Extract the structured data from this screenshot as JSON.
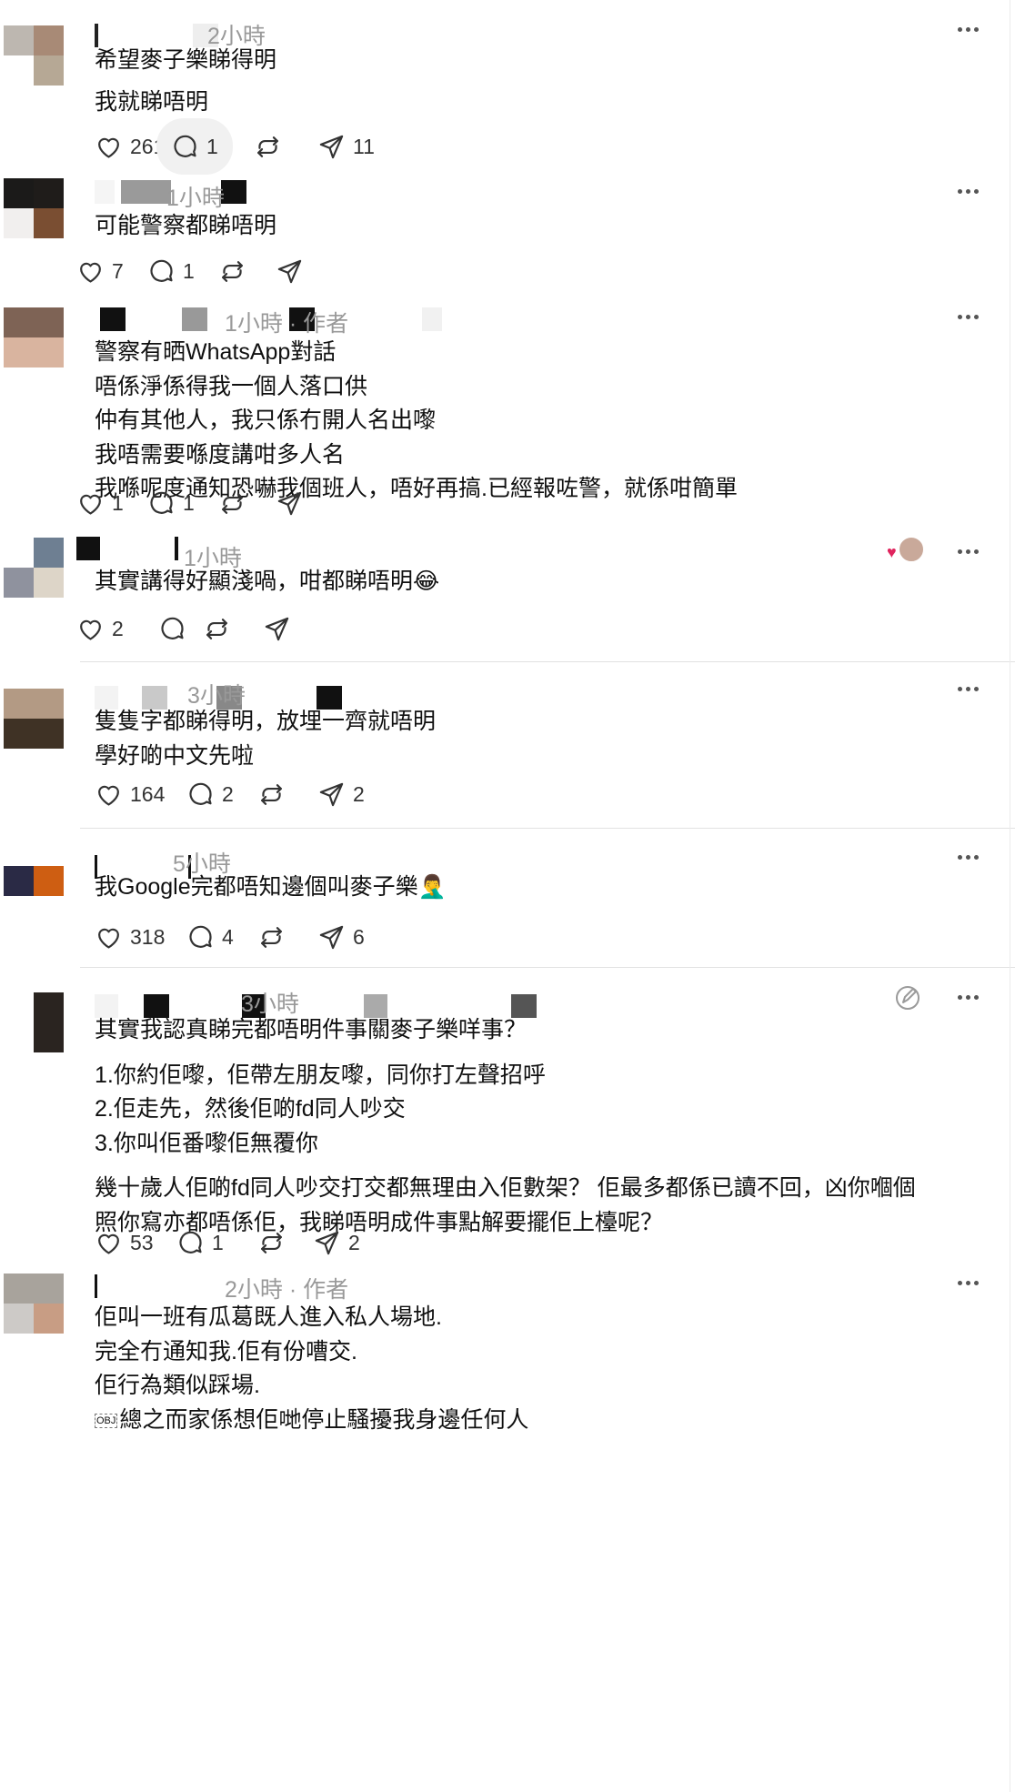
{
  "posts": [
    {
      "time": "2小時",
      "body": [
        "希望麥子樂睇得明",
        "",
        "我就睇唔明"
      ],
      "likes": "261",
      "replies": "1",
      "reposts": "",
      "shares": "11"
    },
    {
      "time": "1小時",
      "body": [
        "可能警察都睇唔明"
      ],
      "likes": "7",
      "replies": "1",
      "reposts": "",
      "shares": ""
    },
    {
      "time": "1小時",
      "author_tag": "作者",
      "body": [
        "警察有晒WhatsApp對話",
        "唔係淨係得我一個人落口供",
        "仲有其他人，我只係冇開人名出嚟",
        "我唔需要喺度講咁多人名",
        "我喺呢度通知恐嚇我個班人，唔好再搞.已經報咗警，就係咁簡單"
      ],
      "likes": "1",
      "replies": "1",
      "reposts": "",
      "shares": ""
    },
    {
      "time": "1小時",
      "body": [
        "其實講得好顯淺喎，咁都睇唔明😂"
      ],
      "likes": "2",
      "replies": "",
      "reposts": "",
      "shares": ""
    },
    {
      "time": "3小時",
      "body": [
        "隻隻字都睇得明，放埋一齊就唔明",
        "學好啲中文先啦"
      ],
      "likes": "164",
      "replies": "2",
      "reposts": "",
      "shares": "2"
    },
    {
      "time": "5小時",
      "body": [
        "我Google完都唔知邊個叫麥子樂🤦‍♂️"
      ],
      "likes": "318",
      "replies": "4",
      "reposts": "",
      "shares": "6"
    },
    {
      "time": "3小時",
      "body": [
        "其實我認真睇完都唔明件事關麥子樂咩事？",
        "",
        "1.你約佢嚟，佢帶左朋友嚟，同你打左聲招呼",
        "2.佢走先，然後佢啲fd同人吵交",
        "3.你叫佢番嚟佢無覆你",
        "",
        "幾十歲人佢啲fd同人吵交打交都無理由入佢數架？ 佢最多都係已讀不回，凶你嗰個",
        "照你寫亦都唔係佢，我睇唔明成件事點解要擺佢上檯呢？"
      ],
      "likes": "53",
      "replies": "1",
      "reposts": "",
      "shares": "2"
    },
    {
      "time": "2小時",
      "author_tag": "作者",
      "body": [
        "佢叫一班有瓜葛既人進入私人場地.",
        "完全冇通知我.佢有份嘈交.",
        "佢行為類似踩場.",
        "總之而家係想佢哋停止騷擾我身邊任何人"
      ],
      "obj_glyph": "OBJ",
      "likes": "",
      "replies": "",
      "reposts": "",
      "shares": ""
    }
  ],
  "separator": " · ",
  "icons": {
    "like": "heart-icon",
    "reply": "comment-icon",
    "repost": "repost-icon",
    "share": "share-icon",
    "more": "more-icon",
    "edit": "edit-icon"
  },
  "colors": {
    "meta": "#999999",
    "reaction_heart": "#e0245e"
  }
}
